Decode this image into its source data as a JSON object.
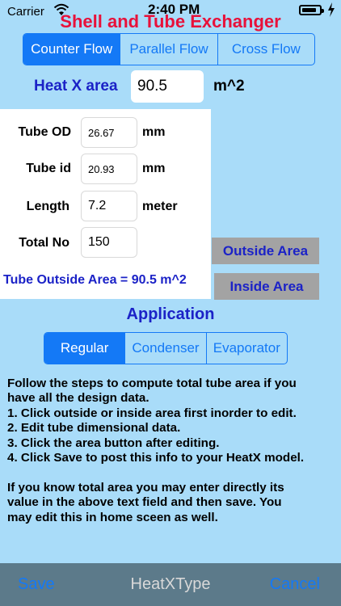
{
  "status": {
    "carrier": "Carrier",
    "time": "2:40 PM"
  },
  "title": "Shell and Tube Exchanger",
  "flow_types": [
    "Counter Flow",
    "Parallel Flow",
    "Cross Flow"
  ],
  "selected_flow": "Counter Flow",
  "heatx": {
    "label": "Heat X area",
    "value": "90.5",
    "unit": "m^2"
  },
  "tube": {
    "od": {
      "label": "Tube OD",
      "value": "26.67",
      "unit": "mm"
    },
    "id": {
      "label": "Tube id",
      "value": "20.93",
      "unit": "mm"
    },
    "length": {
      "label": "Length",
      "value": "7.2",
      "unit": "meter"
    },
    "total": {
      "label": "Total No",
      "value": "150"
    }
  },
  "tube_outside_area_text": "Tube Outside Area = 90.5 m^2",
  "buttons": {
    "outside_area": "Outside Area",
    "inside_area": "Inside Area"
  },
  "application": {
    "title": "Application",
    "options": [
      "Regular",
      "Condenser",
      "Evaporator"
    ],
    "selected": "Regular"
  },
  "instructions": {
    "lines": [
      "Follow the steps to compute total tube area if you",
      "have all the design data.",
      "1. Click outside or inside area first inorder to edit.",
      "2. Edit tube dimensional data.",
      "3. Click the area button after editing.",
      "4. Click Save to post this info to your HeatX model."
    ],
    "note_lines": [
      "If you know total area you may enter directly its",
      "value in the above text field and then save.  You",
      "may edit this in home sceen as well."
    ]
  },
  "toolbar": {
    "save": "Save",
    "title": "HeatXType",
    "cancel": "Cancel"
  },
  "colors": {
    "background": "#a9dcf9",
    "title_red": "#e8113a",
    "accent_blue": "#1479f6",
    "label_blue": "#1b22c7",
    "button_gray": "#a3a3a3",
    "bar": "#5c7a8a"
  },
  "battery_level": 0.85
}
